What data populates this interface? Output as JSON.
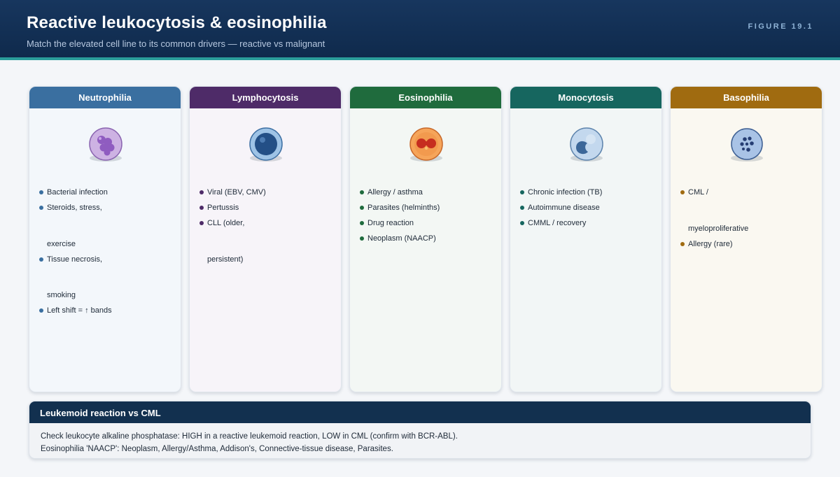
{
  "header": {
    "title": "Reactive leukocytosis & eosinophilia",
    "subtitle": "Match the elevated cell line to its common drivers — reactive vs malignant",
    "figure_tag": "FIGURE 19.1"
  },
  "cards": [
    {
      "title": "Neutrophilia",
      "head_color": "#3a6fa0",
      "body_color": "#f3f7fb",
      "bullet_color": "#3a6fa0",
      "icon": "neutrophil-icon",
      "items": [
        "Bacterial infection",
        "Steroids, stress,",
        "exercise",
        "Tissue necrosis,",
        "smoking",
        "Left shift = ↑ bands"
      ]
    },
    {
      "title": "Lymphocytosis",
      "head_color": "#4e2b68",
      "body_color": "#f7f4f9",
      "bullet_color": "#4e2b68",
      "icon": "lymphocyte-icon",
      "items": [
        "Viral (EBV, CMV)",
        "Pertussis",
        "CLL (older,",
        "persistent)"
      ]
    },
    {
      "title": "Eosinophilia",
      "head_color": "#1f6b3d",
      "body_color": "#f3f7f4",
      "bullet_color": "#1f6b3d",
      "icon": "eosinophil-icon",
      "items": [
        "Allergy / asthma",
        "Parasites (helminths)",
        "Drug reaction",
        "Neoplasm (NAACP)"
      ]
    },
    {
      "title": "Monocytosis",
      "head_color": "#16665f",
      "body_color": "#f2f6f6",
      "bullet_color": "#16665f",
      "icon": "monocyte-icon",
      "items": [
        "Chronic infection (TB)",
        "Autoimmune disease",
        "CMML / recovery"
      ]
    },
    {
      "title": "Basophilia",
      "head_color": "#a06b10",
      "body_color": "#faf8f1",
      "bullet_color": "#a06b10",
      "icon": "basophil-icon",
      "items": [
        "CML /",
        "myeloproliferative",
        "Allergy (rare)"
      ]
    }
  ],
  "note": {
    "title": "Leukemoid reaction vs CML",
    "line1": "Check leukocyte alkaline phosphatase: HIGH in a reactive leukemoid reaction, LOW in CML (confirm with BCR-ABL).",
    "line2": "Eosinophilia 'NAACP': Neoplasm, Allergy/Asthma, Addison's, Connective-tissue disease, Parasites."
  }
}
